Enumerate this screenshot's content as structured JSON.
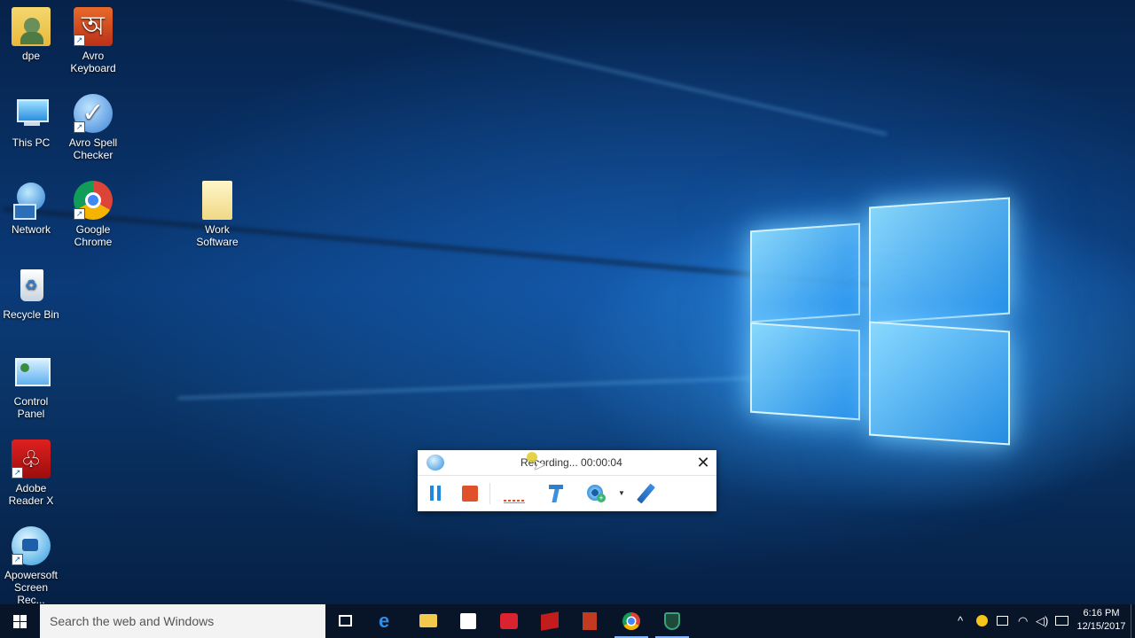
{
  "desktop": {
    "icons": [
      {
        "label": "dpe"
      },
      {
        "label": "Avro Keyboard"
      },
      {
        "label": "This PC"
      },
      {
        "label": "Avro Spell Checker"
      },
      {
        "label": "Network"
      },
      {
        "label": "Google Chrome"
      },
      {
        "label": "Work Software"
      },
      {
        "label": "Recycle Bin"
      },
      {
        "label": "Control Panel"
      },
      {
        "label": "Adobe Reader X"
      },
      {
        "label": "Apowersoft Screen Rec..."
      }
    ]
  },
  "recorder": {
    "status": "Recording... 00:00:04",
    "buttons": {
      "pause": "pause-icon",
      "stop": "stop-icon",
      "audio": "audio-level-icon",
      "toolbox": "toolbox-icon",
      "webcam": "webcam-icon",
      "annotate": "pen-icon"
    }
  },
  "taskbar": {
    "search_placeholder": "Search the web and Windows",
    "time": "6:16 PM",
    "date": "12/15/2017"
  },
  "colors": {
    "accent": "#1a73e8",
    "stop_red": "#e0502a",
    "pause_blue": "#1e88e5",
    "taskbar_bg": "#08142a"
  }
}
